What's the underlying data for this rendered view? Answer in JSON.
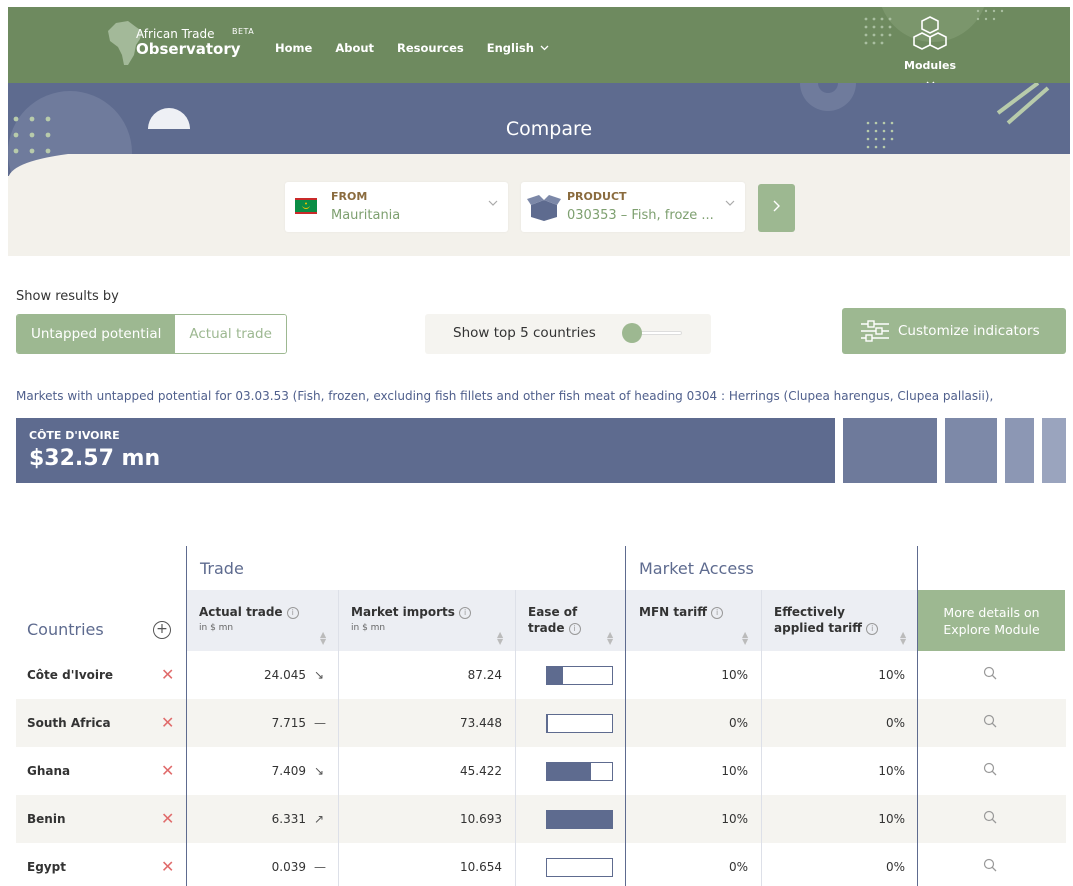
{
  "header": {
    "logo_line1": "African Trade",
    "logo_line2": "Observatory",
    "beta": "BETA",
    "nav": [
      "Home",
      "About",
      "Resources",
      "English"
    ],
    "modules_label": "Modules"
  },
  "hero": {
    "title": "Compare"
  },
  "filters": {
    "from_label": "FROM",
    "from_value": "Mauritania",
    "product_label": "PRODUCT",
    "product_value": "030353 – Fish, froze ..."
  },
  "controls": {
    "show_results_by": "Show results by",
    "toggle_active": "Untapped potential",
    "toggle_inactive": "Actual trade",
    "top_countries": "Show top 5 countries",
    "customize": "Customize indicators"
  },
  "markets_text": "Markets with untapped potential for 03.03.53 (Fish, frozen, excluding fish fillets and other fish meat of heading 0304 : Herrings (Clupea harengus, Clupea pallasii),",
  "treemap": {
    "top_country": "CÔTE D'IVOIRE",
    "top_value": "$32.57 mn"
  },
  "table": {
    "group_trade": "Trade",
    "group_market_access": "Market Access",
    "countries_header": "Countries",
    "headers": {
      "actual_trade": "Actual trade",
      "actual_trade_unit": "in $ mn",
      "market_imports": "Market imports",
      "market_imports_unit": "in $ mn",
      "ease_line1": "Ease of",
      "ease_line2": "trade",
      "mfn": "MFN tariff",
      "eff_line1": "Effectively",
      "eff_line2": "applied tariff",
      "more_line1": "More details on",
      "more_line2": "Explore Module"
    },
    "rows": [
      {
        "country": "Côte d'Ivoire",
        "actual": "24.045",
        "trend": "↘",
        "imports": "87.24",
        "ease": 0.25,
        "mfn": "10%",
        "eff": "10%"
      },
      {
        "country": "South Africa",
        "actual": "7.715",
        "trend": "—",
        "imports": "73.448",
        "ease": 0.02,
        "mfn": "0%",
        "eff": "0%"
      },
      {
        "country": "Ghana",
        "actual": "7.409",
        "trend": "↘",
        "imports": "45.422",
        "ease": 0.68,
        "mfn": "10%",
        "eff": "10%"
      },
      {
        "country": "Benin",
        "actual": "6.331",
        "trend": "↗",
        "imports": "10.693",
        "ease": 1.0,
        "mfn": "10%",
        "eff": "10%"
      },
      {
        "country": "Egypt",
        "actual": "0.039",
        "trend": "—",
        "imports": "10.654",
        "ease": 0.0,
        "mfn": "0%",
        "eff": "0%"
      }
    ]
  },
  "colors": {
    "header_green": "#6e8a5f",
    "hero_blue": "#5e6b8f",
    "accent_green": "#9db891",
    "remove_red": "#e06b6b"
  }
}
